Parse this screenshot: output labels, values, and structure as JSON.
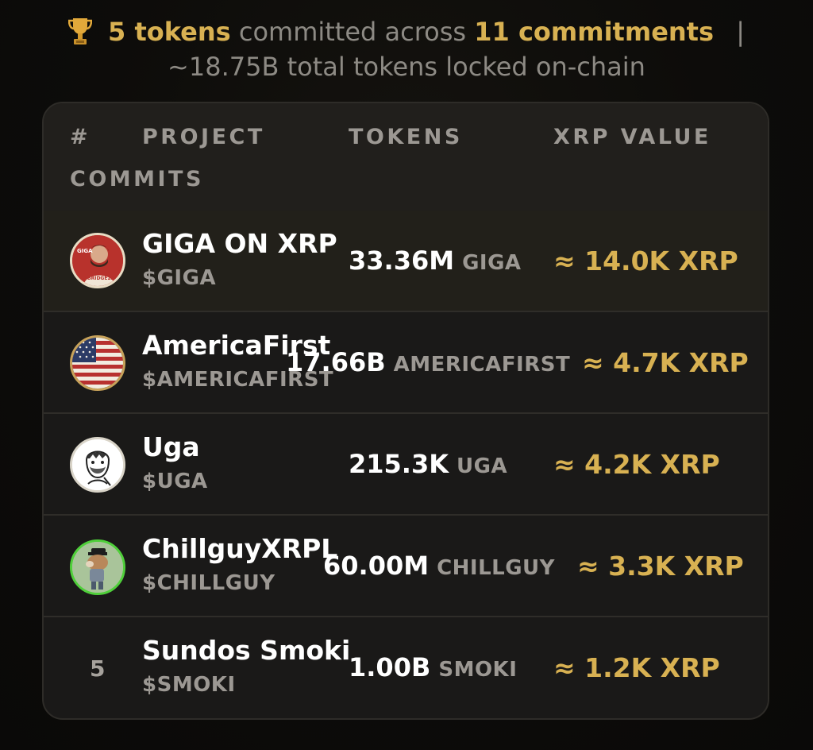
{
  "summary": {
    "tokens_count": "5 tokens",
    "text_committed": "committed across",
    "commitments_count": "11 commitments",
    "separator": "|",
    "total_line": "~18.75B total tokens locked on-chain"
  },
  "table": {
    "headers": {
      "rank": "#",
      "project": "PROJECT",
      "tokens": "TOKENS",
      "xrp_value": "XRP VALUE",
      "commits": "COMMITS"
    },
    "rows": [
      {
        "name": "GIGA ON XRP",
        "ticker": "$GIGA",
        "amount": "33.36M",
        "symbol": "GIGA",
        "xrp": "≈ 14.0K XRP",
        "avatar": "giga-logo-icon"
      },
      {
        "name": "AmericaFirst",
        "ticker": "$AMERICAFIRST",
        "amount": "17.66B",
        "symbol": "AMERICAFIRST",
        "xrp": "≈ 4.7K XRP",
        "avatar": "us-flag-icon"
      },
      {
        "name": "Uga",
        "ticker": "$UGA",
        "amount": "215.3K",
        "symbol": "UGA",
        "xrp": "≈ 4.2K XRP",
        "avatar": "uga-caveman-icon"
      },
      {
        "name": "ChillguyXRPL",
        "ticker": "$CHILLGUY",
        "amount": "60.00M",
        "symbol": "CHILLGUY",
        "xrp": "≈ 3.3K XRP",
        "avatar": "chillguy-dog-icon"
      },
      {
        "name": "Sundos Smoki",
        "ticker": "$SMOKI",
        "amount": "1.00B",
        "symbol": "SMOKI",
        "xrp": "≈ 1.2K XRP",
        "rank": "5"
      }
    ]
  },
  "colors": {
    "accent_gold": "#d8b152",
    "muted_text": "#9c9893",
    "card_bg": "#1a1918"
  }
}
